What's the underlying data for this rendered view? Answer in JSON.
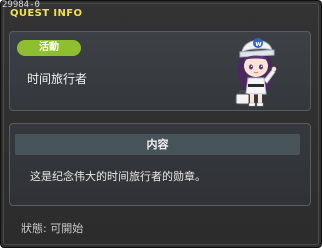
{
  "window": {
    "id": "29984-0",
    "title": "QUEST INFO"
  },
  "quest": {
    "badge": "活動",
    "name": "时间旅行者"
  },
  "content": {
    "header": "内容",
    "description": "这是纪念伟大的时间旅行者的勋章。"
  },
  "status": {
    "text": "狀態:  可開始"
  },
  "colors": {
    "title": "#f2e04a",
    "badge": "#8dbf2e",
    "header_bar": "#47545a"
  }
}
